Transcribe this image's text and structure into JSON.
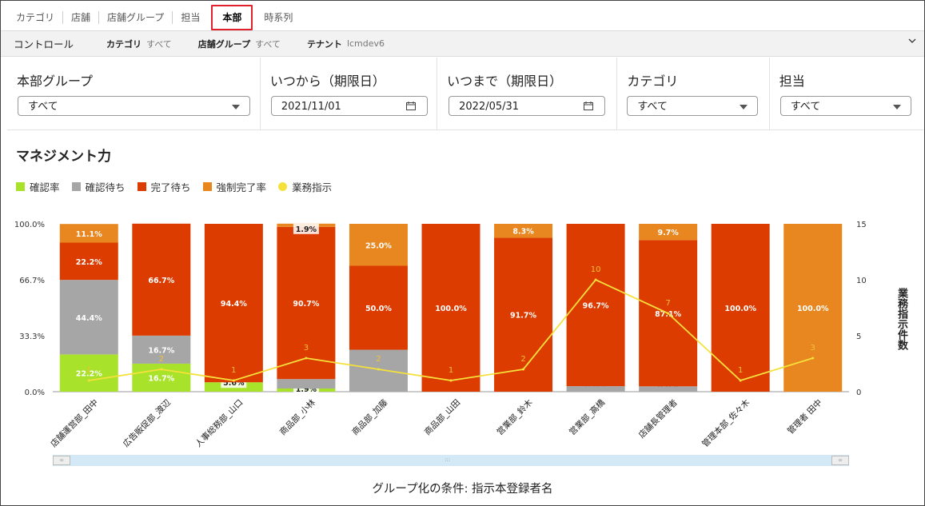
{
  "tabs": [
    "カテゴリ",
    "店舗",
    "店舗グループ",
    "担当",
    "本部",
    "時系列"
  ],
  "active_tab_index": 4,
  "control_bar": {
    "title": "コントロール",
    "items": [
      {
        "key": "カテゴリ",
        "value": "すべて"
      },
      {
        "key": "店舗グループ",
        "value": "すべて"
      },
      {
        "key": "テナント",
        "value": "lcmdev6"
      }
    ]
  },
  "filters": {
    "honbu_group": {
      "label": "本部グループ",
      "value": "すべて"
    },
    "date_from": {
      "label": "いつから（期限日）",
      "value": "2021/11/01"
    },
    "date_to": {
      "label": "いつまで（期限日）",
      "value": "2022/05/31"
    },
    "category": {
      "label": "カテゴリ",
      "value": "すべて"
    },
    "tantou": {
      "label": "担当",
      "value": "すべて"
    }
  },
  "section_title": "マネジメント力",
  "legend": [
    {
      "label": "確認率",
      "color": "#a8e22a",
      "shape": "square"
    },
    {
      "label": "確認待ち",
      "color": "#a6a6a6",
      "shape": "square"
    },
    {
      "label": "完了待ち",
      "color": "#dd3c00",
      "shape": "square"
    },
    {
      "label": "強制完了率",
      "color": "#e8861f",
      "shape": "square"
    },
    {
      "label": "業務指示",
      "color": "#f5e13c",
      "shape": "circle"
    }
  ],
  "chart_data": {
    "type": "bar",
    "stacked": true,
    "categories": [
      "店舗運営部_田中",
      "広告販促部_渡辺",
      "人事総務部_山口",
      "商品部_小林",
      "商品部_加藤",
      "商品部_山田",
      "営業部_鈴木",
      "営業部_高橋",
      "店舗長管理者",
      "管理本部_佐々木",
      "管理者 田中"
    ],
    "series": [
      {
        "name": "確認率",
        "color": "#a8e22a",
        "values": [
          22.2,
          16.7,
          5.6,
          1.9,
          0.0,
          0.0,
          0.0,
          0.0,
          0.0,
          0.0,
          0.0
        ]
      },
      {
        "name": "確認待ち",
        "color": "#a6a6a6",
        "values": [
          44.4,
          16.7,
          0.0,
          5.6,
          25.0,
          0.0,
          0.0,
          3.3,
          3.2,
          0.0,
          0.0
        ]
      },
      {
        "name": "完了待ち",
        "color": "#dd3c00",
        "values": [
          22.2,
          66.7,
          94.4,
          90.7,
          50.0,
          100.0,
          91.7,
          96.7,
          87.1,
          100.0,
          0.0
        ]
      },
      {
        "name": "強制完了率",
        "color": "#e8861f",
        "values": [
          11.1,
          0.0,
          0.0,
          1.9,
          25.0,
          0.0,
          8.3,
          0.0,
          9.7,
          0.0,
          100.0
        ]
      },
      {
        "name": "業務指示",
        "color": "#f5e13c",
        "type": "line",
        "axis": "right",
        "values": [
          1,
          2,
          1,
          3,
          2,
          1,
          2,
          10,
          7,
          1,
          3
        ]
      }
    ],
    "bar_labels": [
      [
        "22.2%",
        "44.4%",
        "22.2%",
        "11.1%"
      ],
      [
        "16.7%",
        "16.7%",
        "66.7%",
        ""
      ],
      [
        "5.6%",
        "",
        "94.4%",
        ""
      ],
      [
        "1.9%",
        "",
        "90.7%",
        "1.9%"
      ],
      [
        "0.0%",
        "",
        "50.0%",
        "25.0%"
      ],
      [
        "0.0%",
        "",
        "100.0%",
        ""
      ],
      [
        "0.0%",
        "",
        "91.7%",
        "8.3%"
      ],
      [
        "0.0%",
        "",
        "96.7%",
        ""
      ],
      [
        "0.0%",
        "",
        "87.1%",
        "9.7%"
      ],
      [
        "0.0%",
        "",
        "100.0%",
        ""
      ],
      [
        "0.0%",
        "",
        "",
        "100.0%"
      ]
    ],
    "y_ticks": [
      "0.0%",
      "33.3%",
      "66.7%",
      "100.0%"
    ],
    "y_tick_values": [
      0,
      33.3,
      66.7,
      100
    ],
    "ylim": [
      0,
      100
    ],
    "y2_ticks": [
      "0",
      "5",
      "10",
      "15"
    ],
    "y2_tick_values": [
      0,
      5,
      10,
      15
    ],
    "y2lim": [
      0,
      15
    ],
    "y2label": "業務指示件数",
    "legend_position": "top-left"
  },
  "group_by_text": "グループ化の条件: 指示本登録者名"
}
